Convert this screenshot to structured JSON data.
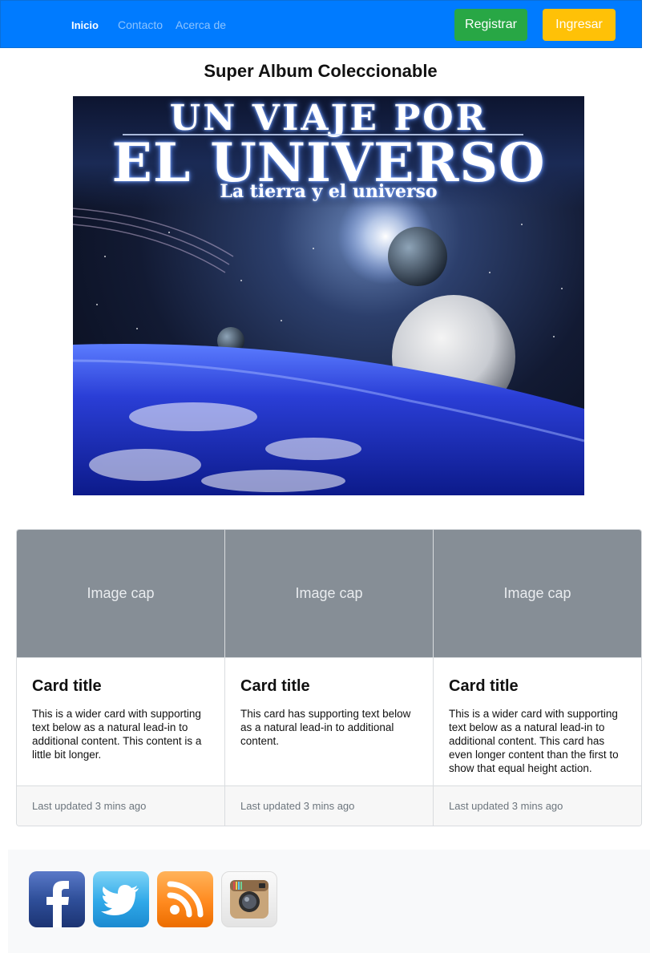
{
  "nav": {
    "home": "Inicio",
    "contact": "Contacto",
    "about": "Acerca de",
    "register": "Registrar",
    "login": "Ingresar"
  },
  "page": {
    "title": "Super Album Coleccionable"
  },
  "hero": {
    "line1": "UN VIAJE POR",
    "line2": "EL UNIVERSO",
    "line3": "La tierra y el universo"
  },
  "cards": [
    {
      "image_cap": "Image cap",
      "title": "Card title",
      "text": "This is a wider card with supporting text below as a natural lead-in to additional content. This content is a little bit longer.",
      "footer": "Last updated 3 mins ago"
    },
    {
      "image_cap": "Image cap",
      "title": "Card title",
      "text": "This card has supporting text below as a natural lead-in to additional content.",
      "footer": "Last updated 3 mins ago"
    },
    {
      "image_cap": "Image cap",
      "title": "Card title",
      "text": "This is a wider card with supporting text below as a natural lead-in to additional content. This card has even longer content than the first to show that equal height action.",
      "footer": "Last updated 3 mins ago"
    }
  ],
  "social": [
    "facebook-icon",
    "twitter-icon",
    "rss-icon",
    "instagram-icon"
  ],
  "colors": {
    "navbar": "#007bff",
    "register": "#28a745",
    "login": "#ffc107",
    "image_cap_bg": "#868e96",
    "footer_bg": "#f8f9fa"
  }
}
